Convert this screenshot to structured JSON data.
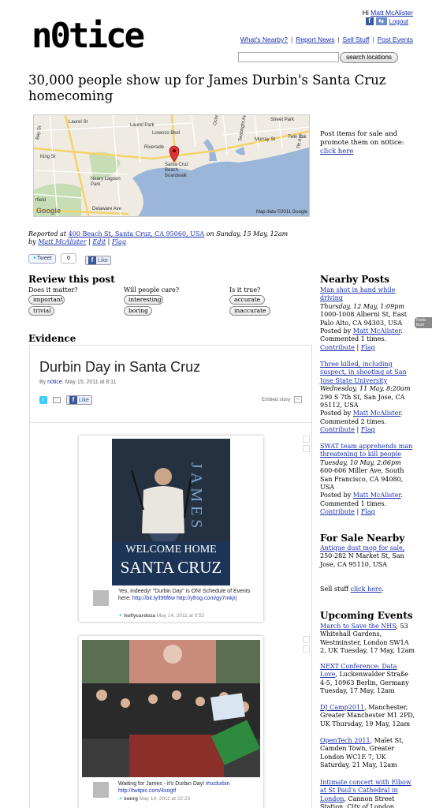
{
  "header": {
    "logo": "n0tice",
    "greeting": "Hi",
    "user_name": "Matt McAlister",
    "logout_label": "Logout",
    "nav": [
      "What's Nearby?",
      "Report News",
      "Sell Stuff",
      "Post Events"
    ],
    "search_value": "",
    "search_button": "search locations"
  },
  "post": {
    "title": "30,000 people show up for James Durbin's Santa Cruz homecoming",
    "map": {
      "labels": [
        "Laurel St",
        "Laurel Park",
        "Bay St",
        "Lorenzo Blvd",
        "Ocean St",
        "Seabright Ave",
        "Street Park",
        "Murray St",
        "Twin Lak",
        "Riverside",
        "Santa Cruz Beach Boardwalk",
        "Neary Lagoon Park",
        "Delaware Ave",
        "rfield",
        "7th Ave",
        "King St"
      ],
      "copyright": "Map data ©2011 Google",
      "brand": "Google"
    },
    "reported_prefix": "Reported at",
    "address": "400 Beach St, Santa Cruz, CA 95060, USA",
    "on_text": "on Sunday, 15 May, 12am by",
    "author": "Matt McAlister",
    "edit": "Edit",
    "flag": "Flag",
    "tweet_label": "Tweet",
    "tweet_count": "0",
    "like_label": "Like"
  },
  "review": {
    "heading": "Review this post",
    "groups": [
      {
        "question": "Does it matter?",
        "options": [
          "important",
          "trivial"
        ]
      },
      {
        "question": "Will people care?",
        "options": [
          "interesting",
          "boring"
        ]
      },
      {
        "question": "Is it true?",
        "options": [
          "accurate",
          "inaccurate"
        ]
      }
    ]
  },
  "evidence": {
    "heading": "Evidence",
    "story_title": "Durbin Day in Santa Cruz",
    "by_prefix": "By",
    "by_user": "n0tice",
    "by_date": ", May 15, 2011 at 8:11",
    "like_label": "Like",
    "embed_label": "Embed story",
    "cards": [
      {
        "image_caption_1": "WELCOME HOME",
        "image_caption_2": "SANTA CRUZ",
        "image_side": "JAMES",
        "text": "Yes, indeedy! \"Durbin Day\" is ON! Schedule of Events here:",
        "link1": "http://bit.ly/l96f8w",
        "link2": "http://yfrog.com/gy7mkjrj",
        "user": "hollycardoza",
        "date": "May 14, 2011 at 0:52"
      },
      {
        "text": "Waiting for James - it's Durbin Day!",
        "hashtag": "#scdurbin",
        "link1": "http://twitpic.com/4xogtf",
        "user": "kenrg",
        "date": "May 14, 2011 at 22:23"
      }
    ]
  },
  "sidebar": {
    "promo_text": "Post items for sale and promote them on n0tice:",
    "promo_link": "click here",
    "nearby_heading": "Nearby Posts",
    "nearby": [
      {
        "title": "Man shot in hand while driving",
        "when": "Thursday, 12 May, 1:09pm",
        "address": "1000-1008 Alberni St, East Palo Alto, CA 94303, USA",
        "posted_by": "Posted by",
        "author": "Matt McAlister",
        "comments": "Commented 1 times.",
        "contribute": "Contribute",
        "flag": "Flag"
      },
      {
        "title": "Three killed, including suspect, in shooting at San Jose State University",
        "when": "Wednesday, 11 May, 8:20am",
        "address": "290 S 7th St, San Jose, CA 95112, USA",
        "posted_by": "Posted by",
        "author": "Matt McAlister",
        "comments": "Commented 2 times.",
        "contribute": "Contribute",
        "flag": "Flag"
      },
      {
        "title": "SWAT team apprehends man threatening to kill people",
        "when": "Tuesday, 10 May, 2:06pm",
        "address": "600-606 Miller Ave, South San Francisco, CA 94080, USA",
        "posted_by": "Posted by",
        "author": "Matt McAlister",
        "comments": "Commented 1 times.",
        "contribute": "Contribute",
        "flag": "Flag"
      }
    ],
    "sale_heading": "For Sale Nearby",
    "sale_item": "Antique dust mop for sale,",
    "sale_address": "250-282 N Market St, San Jose, CA 95110, USA",
    "sell_prefix": "Sell stuff",
    "sell_link": "click here",
    "events_heading": "Upcoming Events",
    "events": [
      {
        "title": "March to Save the NHS",
        "details": ", 53 Whitehall Gardens, Westminster, London SW1A 2, UK Tuesday, 17 May, 12am"
      },
      {
        "title": "NEXT Conference: Data Love",
        "details": ", Luckenwalder Straße 4-5, 10963 Berlin, Germany Tuesday, 17 May, 12am"
      },
      {
        "title": "DJ Camp2011",
        "details": ", Manchester, Greater Manchester M1 2PD, UK Thursday, 19 May, 12am"
      },
      {
        "title": "OpenTech 2011",
        "details": ", Malet St, Camden Town, Greater London WC1E 7, UK Saturday, 21 May, 12am"
      },
      {
        "title": "Intimate concert with Elbow at St Paul's Cathedral in London",
        "details": ", Cannon Street Station, City of London"
      }
    ],
    "fonts_tab": "Fonts from"
  }
}
